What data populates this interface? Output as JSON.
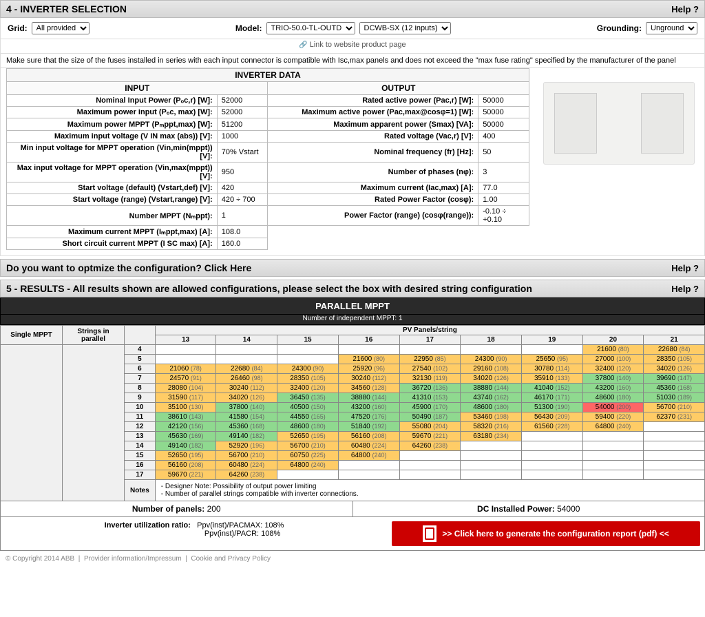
{
  "section4": {
    "title": "4 - INVERTER SELECTION",
    "help": "Help ?",
    "grid_label": "Grid:",
    "grid_value": "All provided",
    "model_label": "Model:",
    "model_value": "TRIO-50.0-TL-OUTD",
    "variant_value": "DCWB-SX (12 inputs)",
    "grounding_label": "Grounding:",
    "grounding_value": "Unground",
    "link_text": "Link to website product page",
    "fuse_note": "Make sure that the size of the fuses installed in series with each input connector is compatible with Isc,max panels and does not exceed the \"max fuse rating\" specified by the manufacturer of the panel"
  },
  "inverter_data": {
    "title": "INVERTER DATA",
    "input_head": "INPUT",
    "output_head": "OUTPUT",
    "input": [
      {
        "label": "Nominal Input Power (Pₒc,r) [W]:",
        "value": "52000"
      },
      {
        "label": "Maximum power input (Pₒc, max) [W]:",
        "value": "52000"
      },
      {
        "label": "Maximum power MPPT (Pₘppt,max) [W]:",
        "value": "51200"
      },
      {
        "label": "Maximum input voltage (V IN max (abs)) [V]:",
        "value": "1000"
      },
      {
        "label": "Min input voltage for MPPT operation (Vin,min(mppt)) [V]:",
        "value": "70% Vstart"
      },
      {
        "label": "Max input voltage for MPPT operation (Vin,max(mppt)) [V]:",
        "value": "950"
      },
      {
        "label": "Start voltage (default) (Vstart,def) [V]:",
        "value": "420"
      },
      {
        "label": "Start voltage (range) (Vstart,range) [V]:",
        "value": "420 ÷ 700"
      },
      {
        "label": "Number MPPT (Nₘppt):",
        "value": "1"
      },
      {
        "label": "Maximum current MPPT (Iₘppt,max) [A]:",
        "value": "108.0"
      },
      {
        "label": "Short circuit current MPPT (I SC max) [A]:",
        "value": "160.0"
      }
    ],
    "output": [
      {
        "label": "Rated active power (Pac,r) [W]:",
        "value": "50000"
      },
      {
        "label": "Maximum active power (Pac,max@cosφ=1) [W]:",
        "value": "50000"
      },
      {
        "label": "Maximum apparent power (Smax) [VA]:",
        "value": "50000"
      },
      {
        "label": "Rated voltage (Vac,r) [V]:",
        "value": "400"
      },
      {
        "label": "Nominal frequency (fr) [Hz]:",
        "value": "50"
      },
      {
        "label": "Number of phases (nφ):",
        "value": "3"
      },
      {
        "label": "Maximum current (Iac,max) [A]:",
        "value": "77.0"
      },
      {
        "label": "Rated Power Factor (cosφ):",
        "value": "1.00"
      },
      {
        "label": "Power Factor (range) (cosφ(range)):",
        "value": "-0.10 ÷ +0.10"
      }
    ]
  },
  "optimize": {
    "text": "Do you want to optmize the configuration? Click Here",
    "help": "Help ?"
  },
  "section5": {
    "title": "5 - RESULTS - All results shown are allowed configurations, please select the box with desired string configuration",
    "help": "Help ?",
    "parallel_title": "PARALLEL MPPT",
    "parallel_sub": "Number of independent MPPT: 1",
    "col_header": "PV Panels/string",
    "row_header": "Strings in parallel",
    "side_label": "Single MPPT",
    "columns": [
      "13",
      "14",
      "15",
      "16",
      "17",
      "18",
      "19",
      "20",
      "21"
    ],
    "rows": [
      {
        "n": "4",
        "cells": [
          null,
          null,
          null,
          null,
          null,
          null,
          null,
          {
            "v": "21600",
            "p": "80",
            "c": "o"
          },
          {
            "v": "22680",
            "p": "84",
            "c": "o"
          }
        ]
      },
      {
        "n": "5",
        "cells": [
          null,
          null,
          null,
          {
            "v": "21600",
            "p": "80",
            "c": "o"
          },
          {
            "v": "22950",
            "p": "85",
            "c": "o"
          },
          {
            "v": "24300",
            "p": "90",
            "c": "o"
          },
          {
            "v": "25650",
            "p": "95",
            "c": "o"
          },
          {
            "v": "27000",
            "p": "100",
            "c": "o"
          },
          {
            "v": "28350",
            "p": "105",
            "c": "o"
          }
        ]
      },
      {
        "n": "6",
        "cells": [
          {
            "v": "21060",
            "p": "78",
            "c": "o"
          },
          {
            "v": "22680",
            "p": "84",
            "c": "o"
          },
          {
            "v": "24300",
            "p": "90",
            "c": "o"
          },
          {
            "v": "25920",
            "p": "96",
            "c": "o"
          },
          {
            "v": "27540",
            "p": "102",
            "c": "o"
          },
          {
            "v": "29160",
            "p": "108",
            "c": "o"
          },
          {
            "v": "30780",
            "p": "114",
            "c": "o"
          },
          {
            "v": "32400",
            "p": "120",
            "c": "o"
          },
          {
            "v": "34020",
            "p": "126",
            "c": "o"
          }
        ]
      },
      {
        "n": "7",
        "cells": [
          {
            "v": "24570",
            "p": "91",
            "c": "o"
          },
          {
            "v": "26460",
            "p": "98",
            "c": "o"
          },
          {
            "v": "28350",
            "p": "105",
            "c": "o"
          },
          {
            "v": "30240",
            "p": "112",
            "c": "o"
          },
          {
            "v": "32130",
            "p": "119",
            "c": "o"
          },
          {
            "v": "34020",
            "p": "126",
            "c": "o"
          },
          {
            "v": "35910",
            "p": "133",
            "c": "o"
          },
          {
            "v": "37800",
            "p": "140",
            "c": "g"
          },
          {
            "v": "39690",
            "p": "147",
            "c": "g"
          }
        ]
      },
      {
        "n": "8",
        "cells": [
          {
            "v": "28080",
            "p": "104",
            "c": "o"
          },
          {
            "v": "30240",
            "p": "112",
            "c": "o"
          },
          {
            "v": "32400",
            "p": "120",
            "c": "o"
          },
          {
            "v": "34560",
            "p": "128",
            "c": "o"
          },
          {
            "v": "36720",
            "p": "136",
            "c": "g"
          },
          {
            "v": "38880",
            "p": "144",
            "c": "g"
          },
          {
            "v": "41040",
            "p": "152",
            "c": "g"
          },
          {
            "v": "43200",
            "p": "160",
            "c": "g"
          },
          {
            "v": "45360",
            "p": "168",
            "c": "g"
          }
        ]
      },
      {
        "n": "9",
        "cells": [
          {
            "v": "31590",
            "p": "117",
            "c": "o"
          },
          {
            "v": "34020",
            "p": "126",
            "c": "o"
          },
          {
            "v": "36450",
            "p": "135",
            "c": "g"
          },
          {
            "v": "38880",
            "p": "144",
            "c": "g"
          },
          {
            "v": "41310",
            "p": "153",
            "c": "g"
          },
          {
            "v": "43740",
            "p": "162",
            "c": "g"
          },
          {
            "v": "46170",
            "p": "171",
            "c": "g"
          },
          {
            "v": "48600",
            "p": "180",
            "c": "g"
          },
          {
            "v": "51030",
            "p": "189",
            "c": "g"
          }
        ]
      },
      {
        "n": "10",
        "cells": [
          {
            "v": "35100",
            "p": "130",
            "c": "o"
          },
          {
            "v": "37800",
            "p": "140",
            "c": "g"
          },
          {
            "v": "40500",
            "p": "150",
            "c": "g"
          },
          {
            "v": "43200",
            "p": "160",
            "c": "g"
          },
          {
            "v": "45900",
            "p": "170",
            "c": "g"
          },
          {
            "v": "48600",
            "p": "180",
            "c": "g"
          },
          {
            "v": "51300",
            "p": "190",
            "c": "g"
          },
          {
            "v": "54000",
            "p": "200",
            "c": "r"
          },
          {
            "v": "56700",
            "p": "210",
            "c": "o"
          }
        ]
      },
      {
        "n": "11",
        "cells": [
          {
            "v": "38610",
            "p": "143",
            "c": "g"
          },
          {
            "v": "41580",
            "p": "154",
            "c": "g"
          },
          {
            "v": "44550",
            "p": "165",
            "c": "g"
          },
          {
            "v": "47520",
            "p": "176",
            "c": "g"
          },
          {
            "v": "50490",
            "p": "187",
            "c": "g"
          },
          {
            "v": "53460",
            "p": "198",
            "c": "o"
          },
          {
            "v": "56430",
            "p": "209",
            "c": "o"
          },
          {
            "v": "59400",
            "p": "220",
            "c": "o"
          },
          {
            "v": "62370",
            "p": "231",
            "c": "o"
          }
        ]
      },
      {
        "n": "12",
        "cells": [
          {
            "v": "42120",
            "p": "156",
            "c": "g"
          },
          {
            "v": "45360",
            "p": "168",
            "c": "g"
          },
          {
            "v": "48600",
            "p": "180",
            "c": "g"
          },
          {
            "v": "51840",
            "p": "192",
            "c": "g"
          },
          {
            "v": "55080",
            "p": "204",
            "c": "o"
          },
          {
            "v": "58320",
            "p": "216",
            "c": "o"
          },
          {
            "v": "61560",
            "p": "228",
            "c": "o"
          },
          {
            "v": "64800",
            "p": "240",
            "c": "o"
          },
          null
        ]
      },
      {
        "n": "13",
        "cells": [
          {
            "v": "45630",
            "p": "169",
            "c": "g"
          },
          {
            "v": "49140",
            "p": "182",
            "c": "g"
          },
          {
            "v": "52650",
            "p": "195",
            "c": "o"
          },
          {
            "v": "56160",
            "p": "208",
            "c": "o"
          },
          {
            "v": "59670",
            "p": "221",
            "c": "o"
          },
          {
            "v": "63180",
            "p": "234",
            "c": "o"
          },
          null,
          null,
          null
        ]
      },
      {
        "n": "14",
        "cells": [
          {
            "v": "49140",
            "p": "182",
            "c": "g"
          },
          {
            "v": "52920",
            "p": "196",
            "c": "o"
          },
          {
            "v": "56700",
            "p": "210",
            "c": "o"
          },
          {
            "v": "60480",
            "p": "224",
            "c": "o"
          },
          {
            "v": "64260",
            "p": "238",
            "c": "o"
          },
          null,
          null,
          null,
          null
        ]
      },
      {
        "n": "15",
        "cells": [
          {
            "v": "52650",
            "p": "195",
            "c": "o"
          },
          {
            "v": "56700",
            "p": "210",
            "c": "o"
          },
          {
            "v": "60750",
            "p": "225",
            "c": "o"
          },
          {
            "v": "64800",
            "p": "240",
            "c": "o"
          },
          null,
          null,
          null,
          null,
          null
        ]
      },
      {
        "n": "16",
        "cells": [
          {
            "v": "56160",
            "p": "208",
            "c": "o"
          },
          {
            "v": "60480",
            "p": "224",
            "c": "o"
          },
          {
            "v": "64800",
            "p": "240",
            "c": "o"
          },
          null,
          null,
          null,
          null,
          null,
          null
        ]
      },
      {
        "n": "17",
        "cells": [
          {
            "v": "59670",
            "p": "221",
            "c": "o"
          },
          {
            "v": "64260",
            "p": "238",
            "c": "o"
          },
          null,
          null,
          null,
          null,
          null,
          null,
          null
        ]
      }
    ],
    "notes_label": "Notes",
    "notes": "- Designer Note: Possibility of output power limiting\n- Number of parallel strings compatible with inverter connections.",
    "num_panels_label": "Number of panels:",
    "num_panels": "200",
    "dc_power_label": "DC Installed Power:",
    "dc_power": "54000",
    "util_label": "Inverter utilization ratio:",
    "util1": "Ppv(inst)/PACMAX: 108%",
    "util2": "Ppv(inst)/PACR: 108%",
    "pdf_button": ">> Click here to generate the configuration report (pdf) <<"
  },
  "footer": {
    "copyright": "© Copyright 2014 ABB",
    "links": [
      "Provider information/Impressum",
      "Cookie and Privacy Policy"
    ]
  }
}
